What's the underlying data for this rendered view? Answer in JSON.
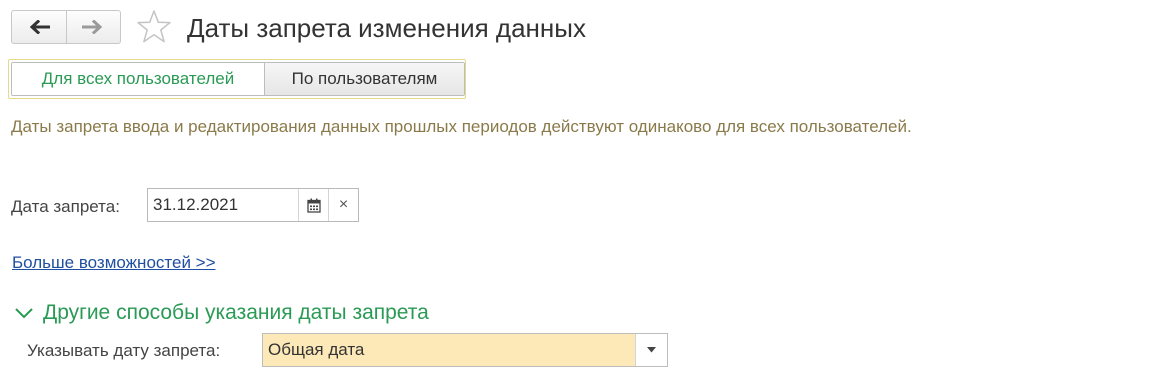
{
  "header": {
    "title": "Даты запрета изменения данных",
    "back_icon": "arrow-left-icon",
    "forward_icon": "arrow-right-icon",
    "favorite_icon": "star-icon"
  },
  "tabs": [
    {
      "label": "Для всех пользователей",
      "active": true
    },
    {
      "label": "По пользователям",
      "active": false
    }
  ],
  "info_text": "Даты запрета ввода и редактирования данных прошлых периодов действуют одинаково для всех пользователей.",
  "date_field": {
    "label": "Дата запрета:",
    "value": "31.12.2021",
    "calendar_icon": "calendar-icon",
    "clear_glyph": "×"
  },
  "more_link": "Больше возможностей >>",
  "group": {
    "title": "Другие способы указания даты запрета",
    "expanded": true,
    "mode_label": "Указывать дату запрета:",
    "mode_value": "Общая дата"
  },
  "colors": {
    "accent_green": "#2a9a55",
    "info_text": "#8a7a4a",
    "link_blue": "#1f4fa0",
    "selected_field_bg": "#fde9b8",
    "tabs_frame": "#e6d98a"
  }
}
